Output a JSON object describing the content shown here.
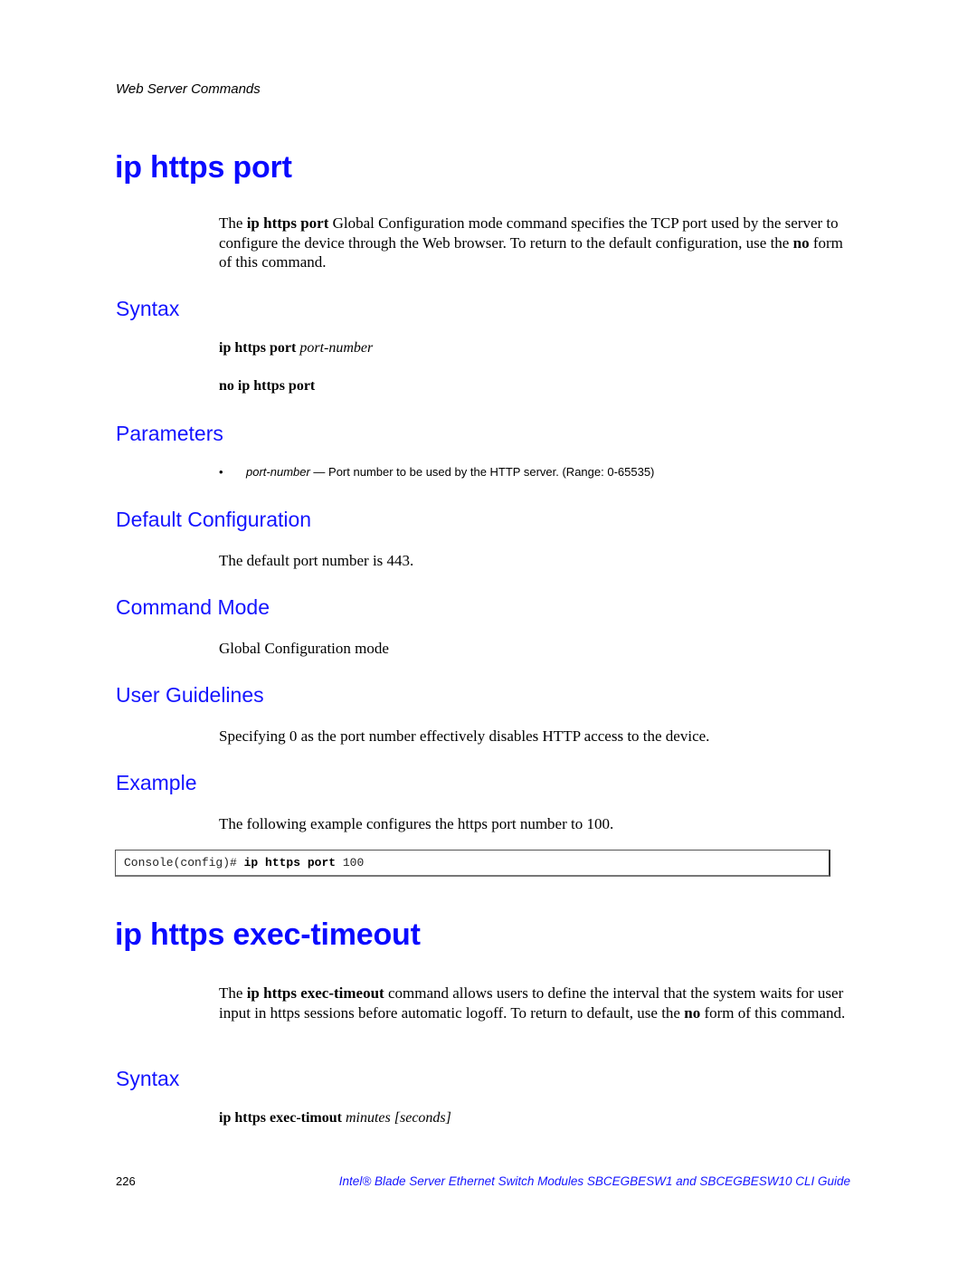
{
  "running_header": "Web Server Commands",
  "sections": {
    "https_port": {
      "title": "ip https port",
      "intro": {
        "pre": "The ",
        "bold": "ip https port",
        "mid": " Global Configuration mode command specifies the TCP port used by the server to configure the device through the Web browser. To return to the default configuration, use the ",
        "bold2": "no",
        "post": " form of this command."
      },
      "syntax_heading": "Syntax",
      "syntax": [
        {
          "bold": "ip https port",
          "italic": "port-number"
        },
        {
          "bold": "no ip https port",
          "italic": ""
        }
      ],
      "parameters_heading": "Parameters",
      "parameters": [
        {
          "name": "port-number",
          "description": " — Port number to be used by the HTTP server. (Range: 0-65535)"
        }
      ],
      "default_heading": "Default Configuration",
      "default_text": "The default port number is 443.",
      "mode_heading": "Command Mode",
      "mode_text": "Global Configuration mode",
      "guidelines_heading": "User Guidelines",
      "guidelines_text": "Specifying 0 as the port number effectively disables HTTP access to the device.",
      "example_heading": "Example",
      "example_text": "The following example configures the https port number to 100.",
      "example_code": {
        "prompt": "Console(config)# ",
        "command": "ip https port",
        "argument": " 100"
      }
    },
    "https_exec_timeout": {
      "title": "ip https exec-timeout",
      "intro": {
        "pre": "The ",
        "bold": "ip https exec-timeout",
        "mid": " command allows users to define the interval that the system waits for user input in https sessions before automatic logoff. To return to default, use the ",
        "bold2": "no",
        "post": " form of this command."
      },
      "syntax_heading": "Syntax",
      "syntax": [
        {
          "bold": "ip https exec-timout",
          "italic": "minutes [seconds]"
        }
      ]
    }
  },
  "footer": {
    "page_number": "226",
    "guide_title": "Intel® Blade Server Ethernet Switch Modules SBCEGBESW1 and SBCEGBESW10 CLI Guide"
  }
}
